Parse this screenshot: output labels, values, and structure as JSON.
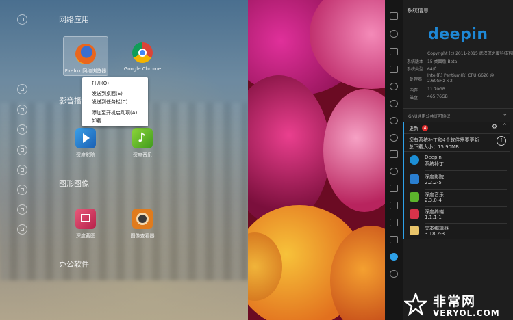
{
  "launcher": {
    "sections": [
      {
        "title": "网络应用"
      },
      {
        "title": "影音播"
      },
      {
        "title": "图形图像"
      },
      {
        "title": "办公软件"
      }
    ],
    "apps": [
      {
        "label": "Firefox 网络浏览器",
        "icon": "firefox-icon"
      },
      {
        "label": "Google Chrome",
        "icon": "chrome-icon"
      },
      {
        "label": "深度影院",
        "icon": "deepin-movie-icon"
      },
      {
        "label": "深度音乐",
        "icon": "deepin-music-icon"
      },
      {
        "label": "深度截图",
        "icon": "deepin-screenshot-icon"
      },
      {
        "label": "图像查看器",
        "icon": "image-viewer-icon"
      }
    ],
    "context_menu": {
      "items": [
        "打开(O)",
        "发送到桌面(E)",
        "发送到任务栏(C)",
        "添加至开机启动项(A)",
        "卸载"
      ]
    }
  },
  "control_center": {
    "title": "系统信息",
    "logo": "deepin",
    "copyright": "Copyright (c) 2011-2015 武汉深之度科技有限公司",
    "info": [
      {
        "label": "系统版本",
        "value": "15 桌面版 Beta"
      },
      {
        "label": "系统类型",
        "value": "64位"
      },
      {
        "label": "处理器",
        "value": "Intel(R) Pentium(R) CPU G620 @ 2.60GHz x 2"
      },
      {
        "label": "内存",
        "value": "11.70GB"
      },
      {
        "label": "磁盘",
        "value": "465.76GB"
      }
    ],
    "license": "GNU通用公共许可协议",
    "update": {
      "title": "更新",
      "badge": "4",
      "summary": "您有系统补丁和4个软件需要更新",
      "size": "总下载大小：15.90MB",
      "packages": [
        {
          "name": "Deepin",
          "version": "系统补丁",
          "color": "#1c8fd6"
        },
        {
          "name": "深度影院",
          "version": "2.2.2-5",
          "color": "#2a7fd0"
        },
        {
          "name": "深度音乐",
          "version": "2.3.0-4",
          "color": "#5cb52c"
        },
        {
          "name": "深度终端",
          "version": "1.1.1-1",
          "color": "#d8334a"
        },
        {
          "name": "文本编辑器",
          "version": "3.18.2-3",
          "color": "#e8c46a"
        }
      ]
    }
  },
  "watermark": {
    "cn": "非常网",
    "en": "VERYOL.COM"
  }
}
